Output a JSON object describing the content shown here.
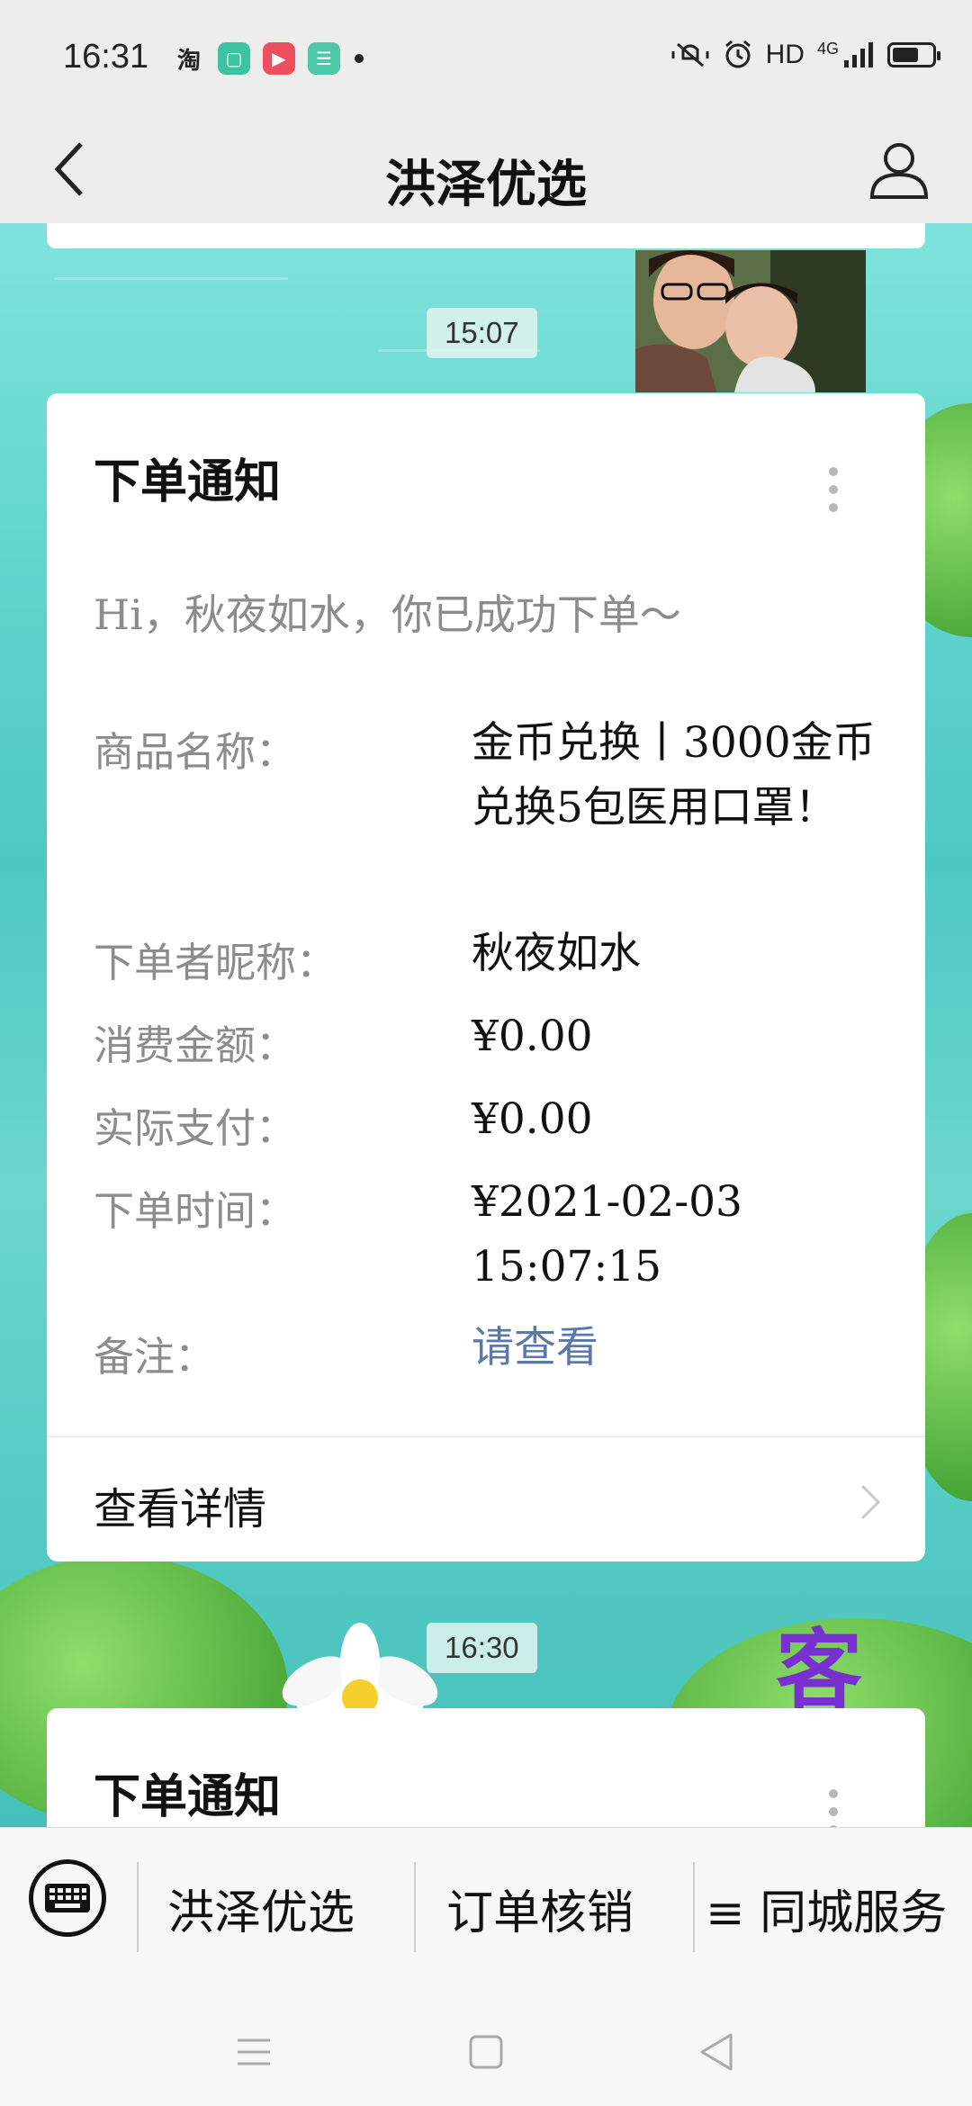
{
  "status_bar": {
    "time": "16:31",
    "taobao_glyph": "淘",
    "network": "HD",
    "signal": "4G"
  },
  "nav": {
    "title": "洪泽优选"
  },
  "messages": [
    {
      "time": "15:07",
      "card": {
        "title": "下单通知",
        "greeting": "Hi，秋夜如水，你已成功下单～",
        "fields": [
          {
            "label": "商品名称：",
            "value": "金币兑换丨3000金币兑换5包医用口罩！"
          },
          {
            "label": "下单者昵称：",
            "value": "秋夜如水"
          },
          {
            "label": "消费金额：",
            "value": "¥0.00"
          },
          {
            "label": "实际支付：",
            "value": "¥0.00"
          },
          {
            "label": "下单时间：",
            "value": "¥2021-02-03 15:07:15"
          },
          {
            "label": "备注：",
            "value": "请查看"
          }
        ],
        "detail_label": "查看详情"
      }
    },
    {
      "time": "16:30",
      "card": {
        "title": "下单通知"
      }
    }
  ],
  "background_decor": {
    "char": "客"
  },
  "bottom_menu": {
    "items": [
      "洪泽优选",
      "订单核销",
      "≡ 同城服务"
    ]
  },
  "colors": {
    "link": "#5b78a8",
    "card_bg": "#ffffff",
    "label_gray": "#8c8c8c",
    "water": "#55cbc4"
  }
}
